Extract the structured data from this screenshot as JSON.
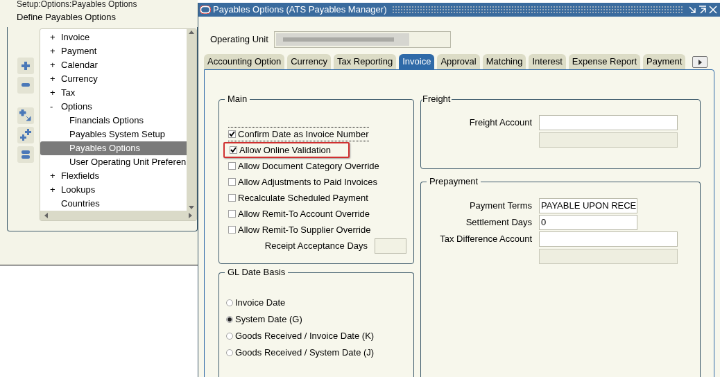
{
  "background_window": {
    "breadcrumb": "Setup:Options:Payables Options",
    "title": "Define Payables Options",
    "tree": [
      {
        "label": "Invoice",
        "expander": "+",
        "selected": false
      },
      {
        "label": "Payment",
        "expander": "+",
        "selected": false
      },
      {
        "label": "Calendar",
        "expander": "+",
        "selected": false
      },
      {
        "label": "Currency",
        "expander": "+",
        "selected": false
      },
      {
        "label": "Tax",
        "expander": "+",
        "selected": false
      },
      {
        "label": "Options",
        "expander": "-",
        "selected": false,
        "children": [
          {
            "label": "Financials Options",
            "selected": false
          },
          {
            "label": "Payables System Setup",
            "selected": false
          },
          {
            "label": "Payables Options",
            "selected": true
          },
          {
            "label": "User Operating Unit Preferen",
            "selected": false
          }
        ]
      },
      {
        "label": "Flexfields",
        "expander": "+",
        "selected": false
      },
      {
        "label": "Lookups",
        "expander": "+",
        "selected": false
      },
      {
        "label": "Countries",
        "selected": false
      }
    ]
  },
  "window": {
    "title": "Payables Options (ATS Payables Manager)"
  },
  "operating_unit": {
    "label": "Operating Unit"
  },
  "tabs": [
    {
      "label": "Accounting Option",
      "selected": false
    },
    {
      "label": "Currency",
      "selected": false
    },
    {
      "label": "Tax Reporting",
      "selected": false
    },
    {
      "label": "Invoice",
      "selected": true
    },
    {
      "label": "Approval",
      "selected": false
    },
    {
      "label": "Matching",
      "selected": false
    },
    {
      "label": "Interest",
      "selected": false
    },
    {
      "label": "Expense Report",
      "selected": false
    },
    {
      "label": "Payment",
      "selected": false
    }
  ],
  "main": {
    "title": "Main",
    "checkboxes": [
      {
        "label": "Confirm Date as Invoice Number",
        "checked": true,
        "focused": true,
        "highlighted": false
      },
      {
        "label": "Allow Online Validation",
        "checked": true,
        "focused": false,
        "highlighted": true
      },
      {
        "label": "Allow Document Category Override",
        "checked": false,
        "focused": false,
        "highlighted": false
      },
      {
        "label": "Allow Adjustments to Paid Invoices",
        "checked": false,
        "focused": false,
        "highlighted": false
      },
      {
        "label": "Recalculate Scheduled Payment",
        "checked": false,
        "focused": false,
        "highlighted": false
      },
      {
        "label": "Allow Remit-To Account Override",
        "checked": false,
        "focused": false,
        "highlighted": false
      },
      {
        "label": "Allow Remit-To Supplier Override",
        "checked": false,
        "focused": false,
        "highlighted": false
      }
    ],
    "receipt_acceptance_days": {
      "label": "Receipt Acceptance Days"
    }
  },
  "gl_date_basis": {
    "title": "GL Date Basis",
    "options": [
      {
        "label": "Invoice Date",
        "selected": false
      },
      {
        "label": "System Date (G)",
        "selected": true
      },
      {
        "label": "Goods Received / Invoice Date (K)",
        "selected": false
      },
      {
        "label": "Goods Received / System Date (J)",
        "selected": false
      }
    ]
  },
  "freight": {
    "title": "Freight",
    "fields": [
      {
        "label": "Freight Account",
        "has_description": true
      }
    ]
  },
  "prepayment": {
    "title": "Prepayment",
    "fields": [
      {
        "label": "Payment Terms",
        "value": "PAYABLE UPON RECE",
        "has_description": false
      },
      {
        "label": "Settlement Days",
        "value": "0",
        "has_description": false
      },
      {
        "label": "Tax Difference Account",
        "has_description": true
      }
    ]
  }
}
